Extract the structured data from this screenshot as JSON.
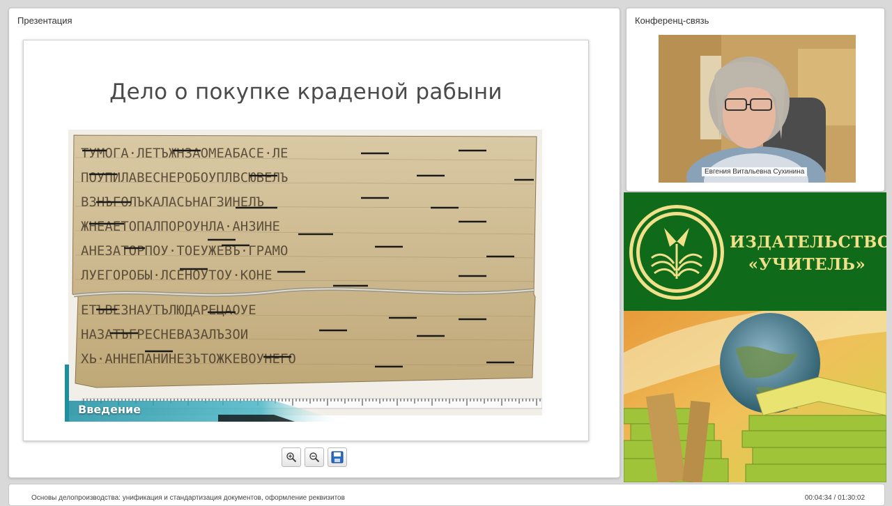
{
  "presentation": {
    "panel_title": "Презентация",
    "slide": {
      "title": "Дело о покупке краденой рабыни",
      "badge_label": "Введение"
    },
    "toolbar": [
      {
        "name": "zoom-in",
        "icon": "zoom-in-icon"
      },
      {
        "name": "zoom-out",
        "icon": "zoom-out-icon"
      },
      {
        "name": "save",
        "icon": "save-icon"
      }
    ]
  },
  "conference": {
    "panel_title": "Конференц-связь",
    "speaker_name": "Евгения Витальевна Сухинина"
  },
  "ad": {
    "line1": "ИЗДАТЕЛЬСТВО",
    "line2": "«УЧИТЕЛЬ»"
  },
  "footer": {
    "course_title": "Основы делопроизводства: унификация и стандартизация документов, оформление реквизитов",
    "time_current": "00:04:34",
    "time_total": "01:30:02",
    "time_display": "00:04:34 / 01:30:02"
  },
  "colors": {
    "ad_green": "#0f6a1a",
    "ad_text": "#f1e08a",
    "badge_teal": "#1d8fa2"
  }
}
